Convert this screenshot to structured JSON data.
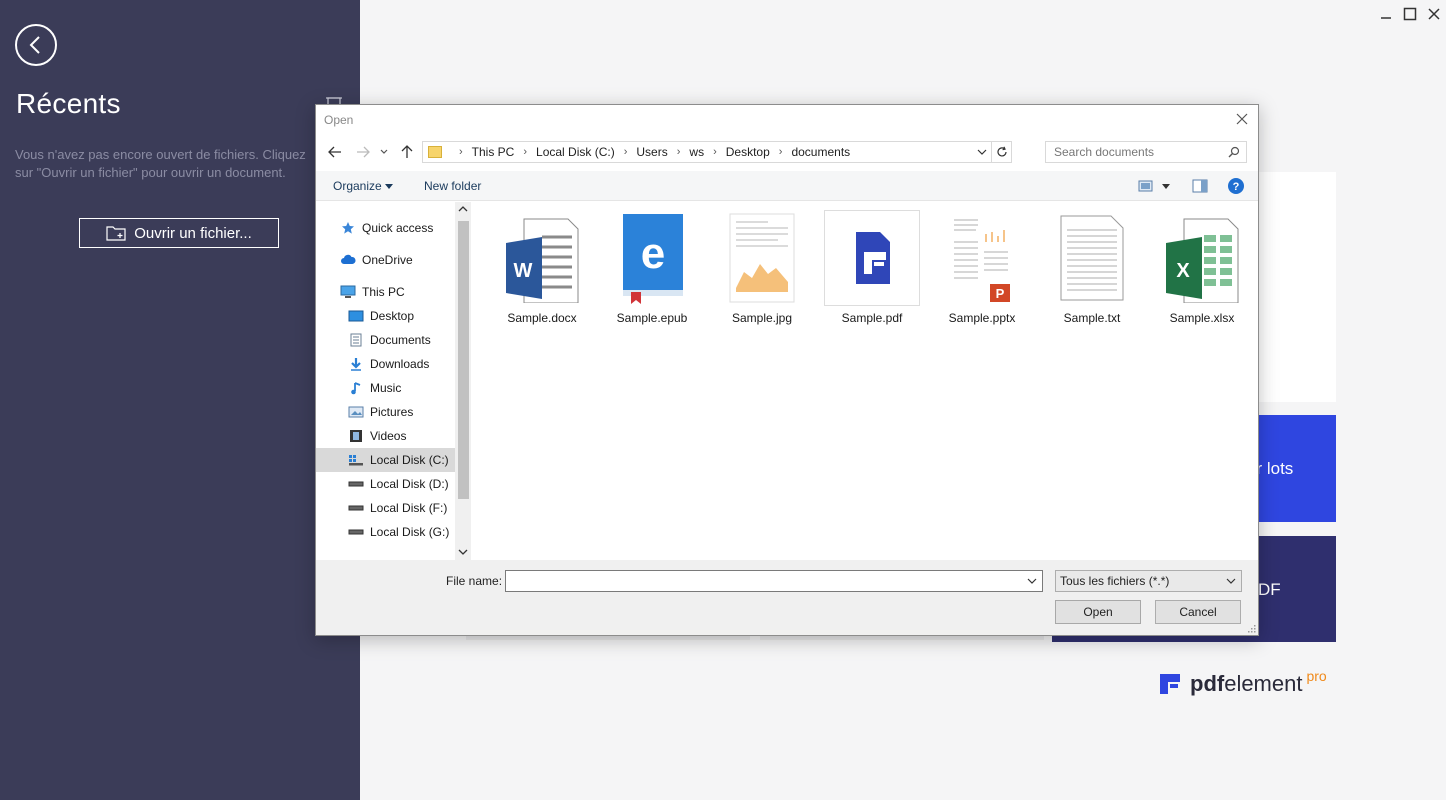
{
  "sidebar": {
    "title": "Récents",
    "empty_message": "Vous n'avez pas encore ouvert de fichiers. Cliquez sur \"Ouvrir un fichier\" pour ouvrir un document.",
    "open_file_label": "Ouvrir un fichier..."
  },
  "background_cards": {
    "batch_label": "ar lots",
    "pdf_label": "DF"
  },
  "brand": {
    "bold": "pdf",
    "rest": "element",
    "suffix": "pro"
  },
  "dialog": {
    "title": "Open",
    "breadcrumbs": [
      "This PC",
      "Local Disk (C:)",
      "Users",
      "ws",
      "Desktop",
      "documents"
    ],
    "search_placeholder": "Search documents",
    "toolbar": {
      "organize": "Organize",
      "new_folder": "New folder"
    },
    "nav": {
      "quick_access": "Quick access",
      "onedrive": "OneDrive",
      "this_pc": "This PC",
      "desktop": "Desktop",
      "documents": "Documents",
      "downloads": "Downloads",
      "music": "Music",
      "pictures": "Pictures",
      "videos": "Videos",
      "disk_c": "Local Disk (C:)",
      "disk_d": "Local Disk (D:)",
      "disk_f": "Local Disk (F:)",
      "disk_g": "Local Disk (G:)"
    },
    "files": [
      "Sample.docx",
      "Sample.epub",
      "Sample.jpg",
      "Sample.pdf",
      "Sample.pptx",
      "Sample.txt",
      "Sample.xlsx"
    ],
    "file_name_label": "File name:",
    "file_name_value": "",
    "file_type": "Tous les fichiers (*.*)",
    "open_label": "Open",
    "cancel_label": "Cancel"
  },
  "colors": {
    "sidebar_bg": "#3b3c58",
    "accent_blue": "#2f46e0",
    "navy": "#2f2f6e",
    "brand_orange": "#f08a1b"
  }
}
